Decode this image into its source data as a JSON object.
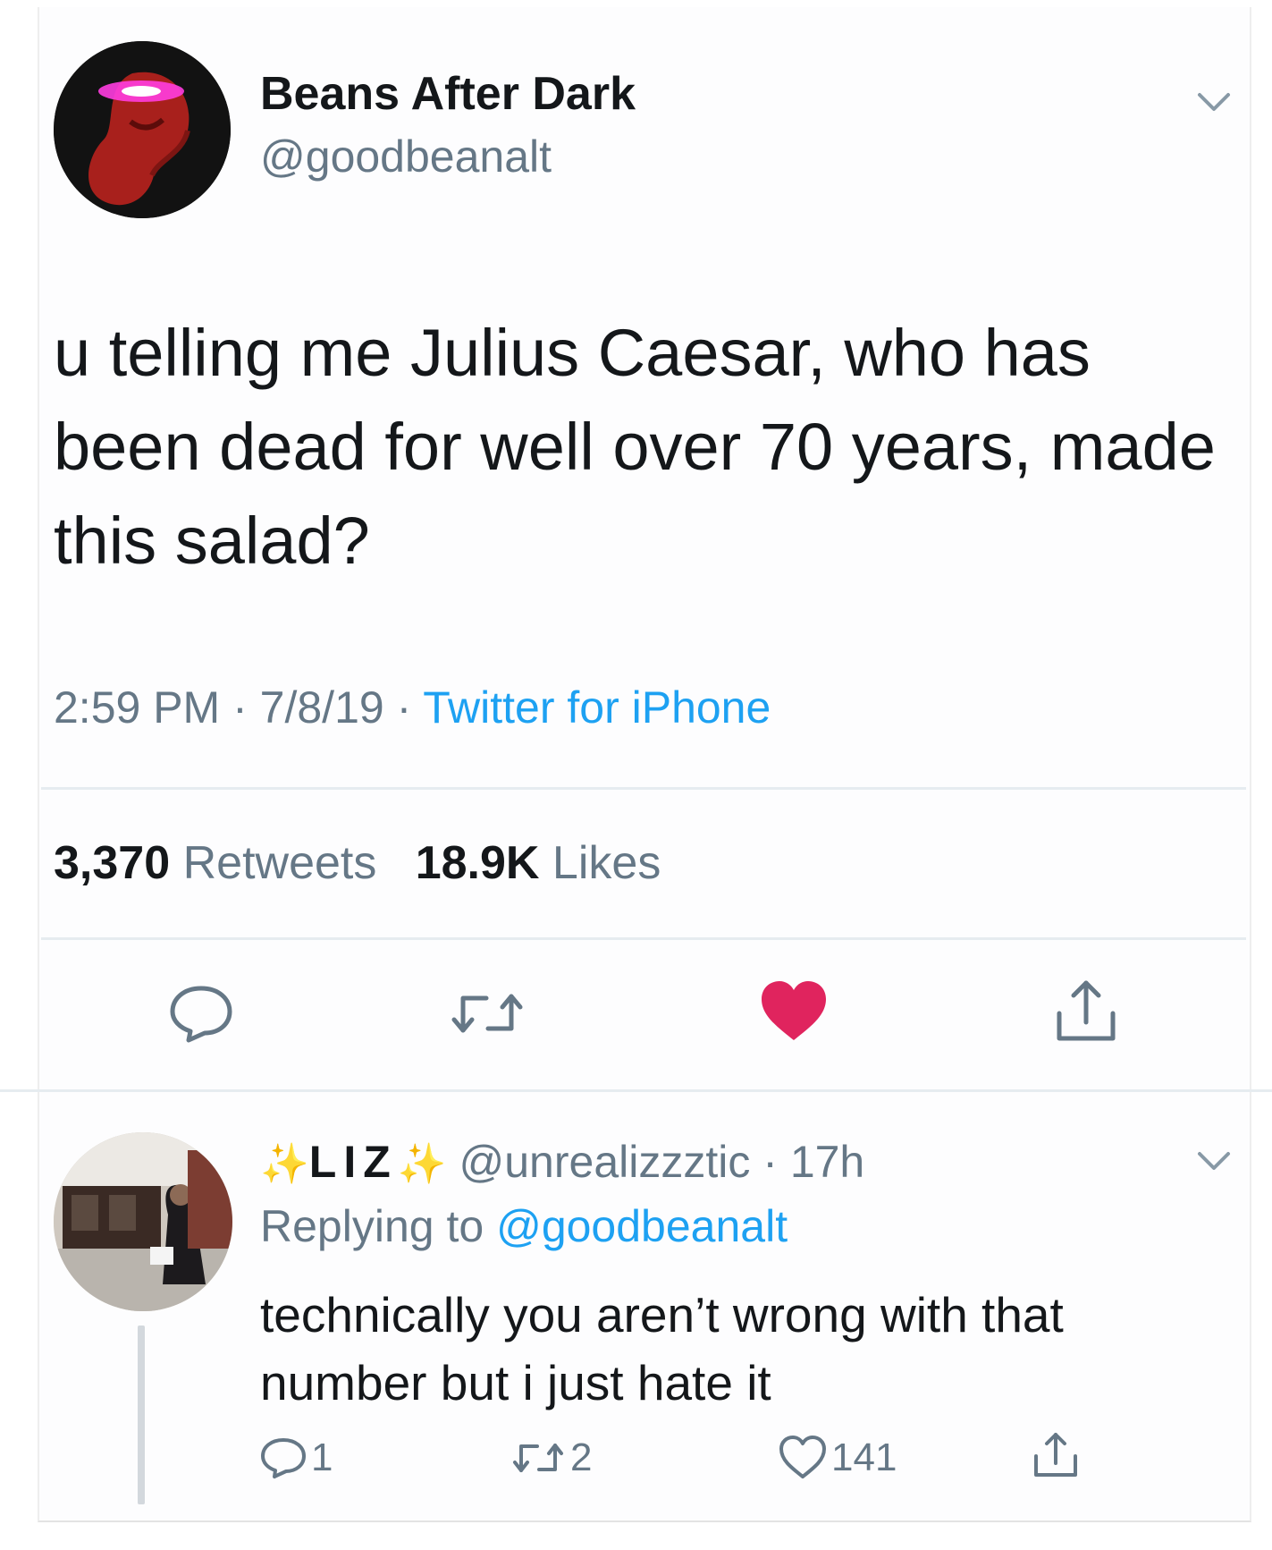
{
  "tweet": {
    "author_name": "Beans After Dark",
    "author_handle": "@goodbeanalt",
    "text": "u telling me Julius Caesar, who has been dead for well over 70 years, made this salad?",
    "time": "2:59 PM",
    "date": "7/8/19",
    "source": "Twitter for iPhone",
    "retweets_count": "3,370",
    "retweets_label": "Retweets",
    "likes_count": "18.9K",
    "likes_label": "Likes",
    "liked": true
  },
  "reply": {
    "author_name": "LIZ",
    "author_handle": "@unrealizzztic",
    "age": "17h",
    "replying_prefix": "Replying to",
    "replying_to": "@goodbeanalt",
    "text": "technically you aren’t wrong with that number but i just hate it",
    "reply_count": "1",
    "retweet_count": "2",
    "like_count": "141"
  },
  "colors": {
    "accent": "#1da1f2",
    "like": "#e0245e",
    "muted": "#657786"
  },
  "icons": [
    "chevron-down-icon",
    "reply-icon",
    "retweet-icon",
    "heart-icon",
    "share-icon",
    "sparkle-icon"
  ]
}
